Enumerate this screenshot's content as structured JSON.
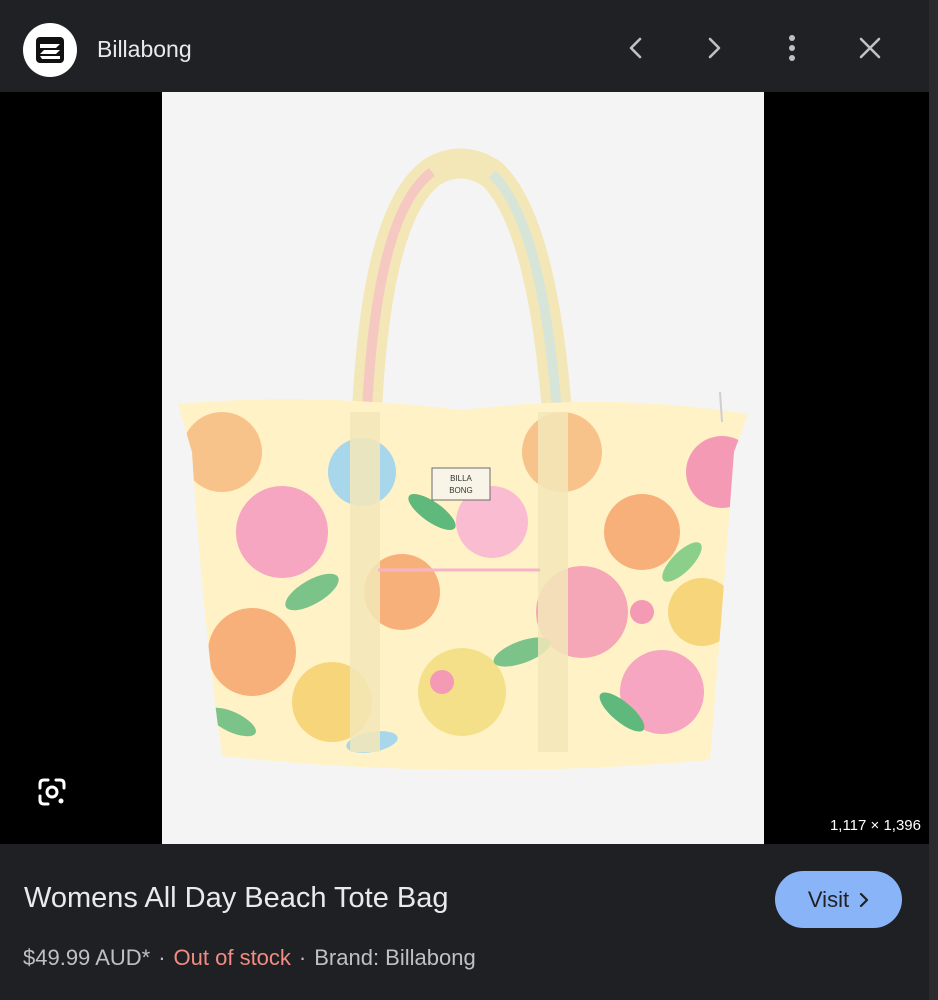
{
  "header": {
    "site_name": "Billabong",
    "logo_icon": "billabong-logo-icon",
    "prev_icon": "chevron-left-icon",
    "next_icon": "chevron-right-icon",
    "more_icon": "more-vert-icon",
    "close_icon": "close-icon"
  },
  "image": {
    "brand_patch_line1": "BILLA",
    "brand_patch_line2": "BONG",
    "dimensions": "1,117 × 1,396",
    "lens_icon": "google-lens-icon"
  },
  "product": {
    "title": "Womens All Day Beach Tote Bag",
    "price": "$49.99 AUD*",
    "separator": "·",
    "stock_status": "Out of stock",
    "brand": "Brand: Billabong",
    "visit_label": "Visit",
    "visit_icon": "chevron-right-icon"
  },
  "colors": {
    "background": "#202124",
    "accent": "#8ab4f8",
    "out_of_stock": "#f28b82"
  }
}
